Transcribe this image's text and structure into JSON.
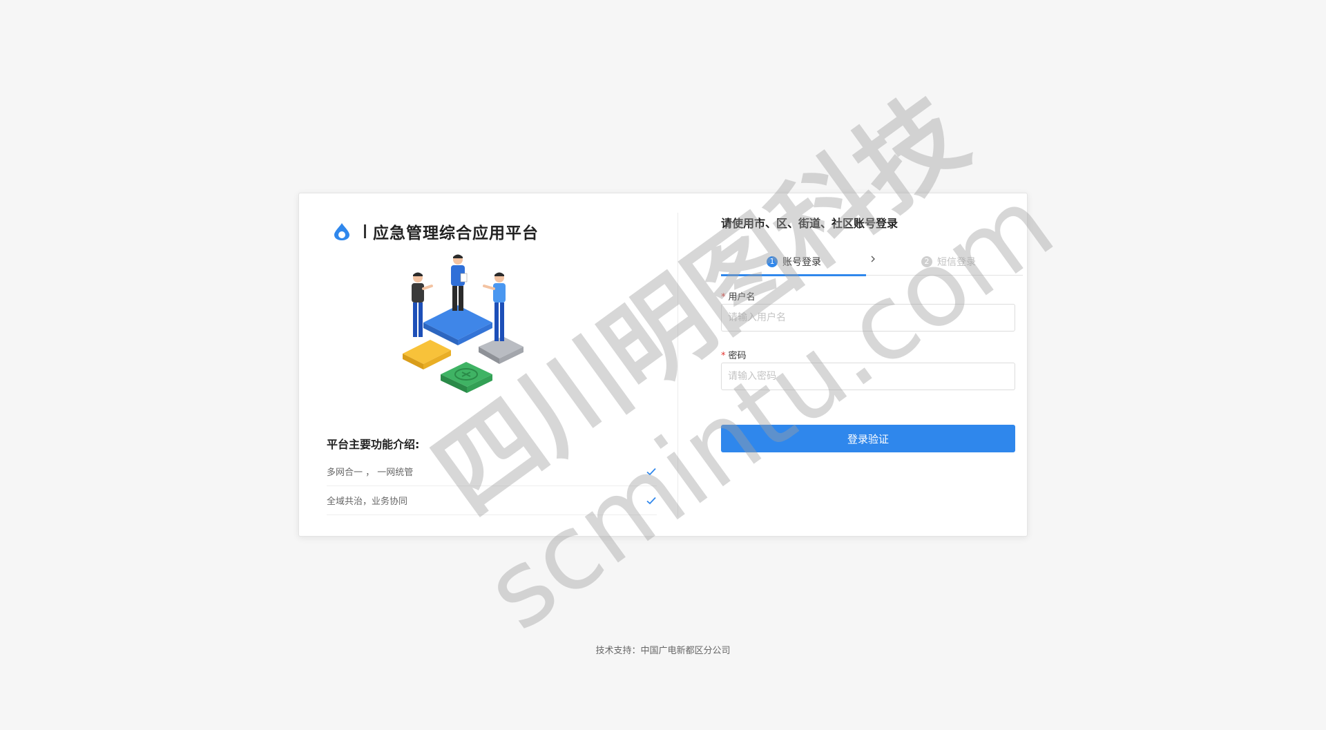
{
  "brand": {
    "title": "应急管理综合应用平台",
    "logo_icon": "droplet-logo-icon",
    "accent_color": "#2f87ec"
  },
  "features": {
    "title": "平台主要功能介绍:",
    "items": [
      {
        "label": "多网合一 ， 一网统管",
        "icon": "check-icon"
      },
      {
        "label": "全域共治，业务协同",
        "icon": "check-icon"
      }
    ]
  },
  "login": {
    "title": "请使用市、区、街道、社区账号登录",
    "tabs": [
      {
        "num": "1",
        "label": "账号登录",
        "active": true
      },
      {
        "num": "2",
        "label": "短信登录",
        "active": false
      }
    ],
    "username": {
      "label": "用户名",
      "required_mark": "*",
      "placeholder": "请输入用户名"
    },
    "password": {
      "label": "密码",
      "required_mark": "*",
      "placeholder": "请输入密码"
    },
    "submit_label": "登录验证",
    "button_color": "#2f87ec"
  },
  "footer": {
    "text": "技术支持：中国广电新都区分公司"
  },
  "watermark": {
    "line1": "四川明图科技",
    "line2": "scmintu.com"
  }
}
